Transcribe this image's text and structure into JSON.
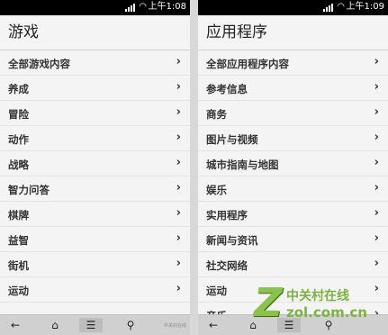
{
  "status": {
    "time": "上午1:08",
    "time2": "上午1:09",
    "wifi_icon": "wifi-icon"
  },
  "left": {
    "title": "游戏",
    "items": [
      {
        "label": "全部游戏内容"
      },
      {
        "label": "养成"
      },
      {
        "label": "冒险"
      },
      {
        "label": "动作"
      },
      {
        "label": "战略"
      },
      {
        "label": "智力问答"
      },
      {
        "label": "棋牌"
      },
      {
        "label": "益智"
      },
      {
        "label": "街机"
      },
      {
        "label": "运动"
      }
    ]
  },
  "right": {
    "title": "应用程序",
    "items": [
      {
        "label": "全部应用程序内容"
      },
      {
        "label": "参考信息"
      },
      {
        "label": "商务"
      },
      {
        "label": "图片与视频"
      },
      {
        "label": "城市指南与地图"
      },
      {
        "label": "娱乐"
      },
      {
        "label": "实用程序"
      },
      {
        "label": "新闻与资讯"
      },
      {
        "label": "社交网络"
      },
      {
        "label": "运动"
      },
      {
        "label": "音乐"
      }
    ]
  },
  "chevron": "›",
  "toolbar": {
    "back": "←",
    "home": "⌂",
    "list": "☰",
    "search": "⚲"
  },
  "watermark": {
    "cn": "中关村在线",
    "en": "zol.com.cn",
    "small": "中关村在线"
  }
}
